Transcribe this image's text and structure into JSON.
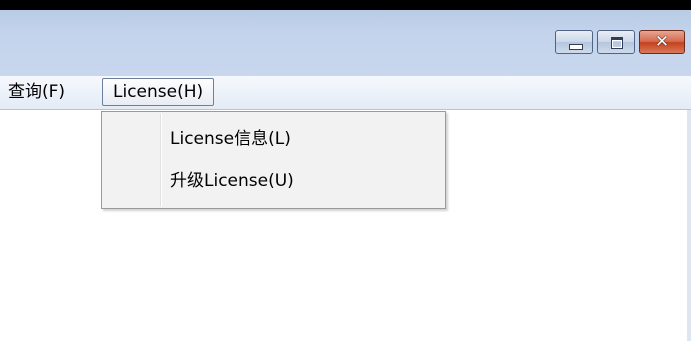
{
  "window": {
    "caption_buttons": {
      "minimize_icon": "minimize-icon",
      "maximize_icon": "maximize-icon",
      "close_glyph": "✕"
    }
  },
  "menubar": {
    "items": [
      {
        "label": "查询(F)"
      },
      {
        "label": "License(H)"
      }
    ]
  },
  "dropdown": {
    "items": [
      {
        "label": "License信息(L)"
      },
      {
        "label": "升级License(U)"
      }
    ]
  }
}
